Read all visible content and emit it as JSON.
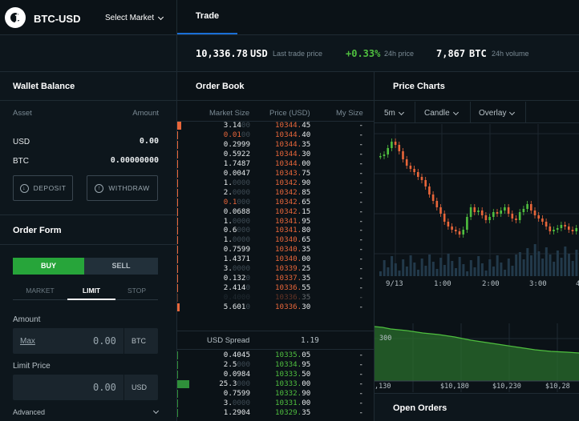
{
  "nav": {
    "tab_trade": "Trade"
  },
  "market": {
    "pair": "BTC-USD",
    "select_label": "Select Market",
    "last_price": "10,336.78",
    "last_price_unit": "USD",
    "last_price_label": "Last trade price",
    "change": "+0.33%",
    "change_label": "24h price",
    "volume": "7,867",
    "volume_unit": "BTC",
    "volume_label": "24h volume"
  },
  "wallet": {
    "title": "Wallet Balance",
    "col_asset": "Asset",
    "col_amount": "Amount",
    "rows": [
      {
        "asset": "USD",
        "amount": "0.00"
      },
      {
        "asset": "BTC",
        "amount": "0.00000000"
      }
    ],
    "deposit_label": "DEPOSIT",
    "withdraw_label": "WITHDRAW"
  },
  "order_form": {
    "title": "Order Form",
    "buy_label": "BUY",
    "sell_label": "SELL",
    "type_tabs": [
      "MARKET",
      "LIMIT",
      "STOP"
    ],
    "selected_type": "LIMIT",
    "amount_label": "Amount",
    "max_label": "Max",
    "amount_value": "0.00",
    "amount_unit": "BTC",
    "limit_price_label": "Limit Price",
    "limit_price_value": "0.00",
    "limit_price_unit": "USD",
    "advanced_label": "Advanced"
  },
  "order_book": {
    "title": "Order Book",
    "col_market_size": "Market Size",
    "col_price": "Price (USD)",
    "col_my_size": "My Size",
    "asks": [
      {
        "size": "3.14",
        "pad": "00",
        "price": "10344.",
        "cents": "45",
        "my": "-",
        "depth": 0.02
      },
      {
        "size": "0.01",
        "pad": "00",
        "price": "10344.",
        "cents": "40",
        "my": "-",
        "depth": 0.0,
        "size_color": "#e8663a"
      },
      {
        "size": "0.2999",
        "pad": "",
        "price": "10344.",
        "cents": "35",
        "my": "-",
        "depth": 0.0
      },
      {
        "size": "0.5922",
        "pad": "",
        "price": "10344.",
        "cents": "30",
        "my": "-",
        "depth": 0.0
      },
      {
        "size": "1.7487",
        "pad": "",
        "price": "10344.",
        "cents": "00",
        "my": "-",
        "depth": 0.0
      },
      {
        "size": "0.0047",
        "pad": "",
        "price": "10343.",
        "cents": "75",
        "my": "-",
        "depth": 0.0
      },
      {
        "size": "1.",
        "pad": "0000",
        "price": "10342.",
        "cents": "90",
        "my": "-",
        "depth": 0.0
      },
      {
        "size": "2.",
        "pad": "0000",
        "price": "10342.",
        "cents": "85",
        "my": "-",
        "depth": 0.0
      },
      {
        "size": "0.1",
        "pad": "000",
        "price": "10342.",
        "cents": "65",
        "my": "-",
        "depth": 0.0,
        "size_color": "#e8663a"
      },
      {
        "size": "0.0688",
        "pad": "",
        "price": "10342.",
        "cents": "15",
        "my": "-",
        "depth": 0.0
      },
      {
        "size": "1.",
        "pad": "0000",
        "price": "10341.",
        "cents": "95",
        "my": "-",
        "depth": 0.0
      },
      {
        "size": "0.6",
        "pad": "000",
        "price": "10341.",
        "cents": "80",
        "my": "-",
        "depth": 0.0
      },
      {
        "size": "1.",
        "pad": "0000",
        "price": "10340.",
        "cents": "65",
        "my": "-",
        "depth": 0.0
      },
      {
        "size": "0.7599",
        "pad": "",
        "price": "10340.",
        "cents": "35",
        "my": "-",
        "depth": 0.0
      },
      {
        "size": "1.4371",
        "pad": "",
        "price": "10340.",
        "cents": "00",
        "my": "-",
        "depth": 0.0
      },
      {
        "size": "3.",
        "pad": "0000",
        "price": "10339.",
        "cents": "25",
        "my": "-",
        "depth": 0.0
      },
      {
        "size": "0.132",
        "pad": "0",
        "price": "10337.",
        "cents": "35",
        "my": "-",
        "depth": 0.0
      },
      {
        "size": "2.414",
        "pad": "0",
        "price": "10336.",
        "cents": "55",
        "my": "-",
        "depth": 0.0
      },
      {
        "size": "",
        "pad": "0.4000",
        "price": "10336.",
        "cents": "35",
        "my": "-",
        "depth": 0.0,
        "faded": true
      },
      {
        "size": "5.601",
        "pad": "0",
        "price": "10336.",
        "cents": "30",
        "my": "-",
        "depth": 0.012
      }
    ],
    "spread_label": "USD Spread",
    "spread_value": "1.19",
    "bids": [
      {
        "size": "0.4045",
        "pad": "",
        "price": "10335.",
        "cents": "05",
        "my": "-",
        "depth": 0.0
      },
      {
        "size": "2.5",
        "pad": "000",
        "price": "10334.",
        "cents": "95",
        "my": "-",
        "depth": 0.0
      },
      {
        "size": "0.0984",
        "pad": "",
        "price": "10333.",
        "cents": "50",
        "my": "-",
        "depth": 0.0
      },
      {
        "size": "25.3",
        "pad": "000",
        "price": "10333.",
        "cents": "00",
        "my": "-",
        "depth": 0.06
      },
      {
        "size": "0.7599",
        "pad": "",
        "price": "10332.",
        "cents": "90",
        "my": "-",
        "depth": 0.0
      },
      {
        "size": "3.",
        "pad": "0000",
        "price": "10331.",
        "cents": "00",
        "my": "-",
        "depth": 0.0
      },
      {
        "size": "1.2904",
        "pad": "",
        "price": "10329.",
        "cents": "35",
        "my": "-",
        "depth": 0.0
      }
    ]
  },
  "charts": {
    "title": "Price Charts",
    "interval": "5m",
    "style": "Candle",
    "overlay": "Overlay",
    "time_ticks": [
      "9/13",
      "1:00",
      "2:00",
      "3:00",
      "4"
    ],
    "depth_y_tick": "300",
    "depth_x_ticks": ",130",
    "depth_x_ticks_list": [
      ",130",
      "$10,180",
      "$10,230",
      "$10,28"
    ],
    "up_color": "#4fbf3f",
    "down_color": "#e8663a"
  },
  "open_orders": {
    "title": "Open Orders"
  }
}
